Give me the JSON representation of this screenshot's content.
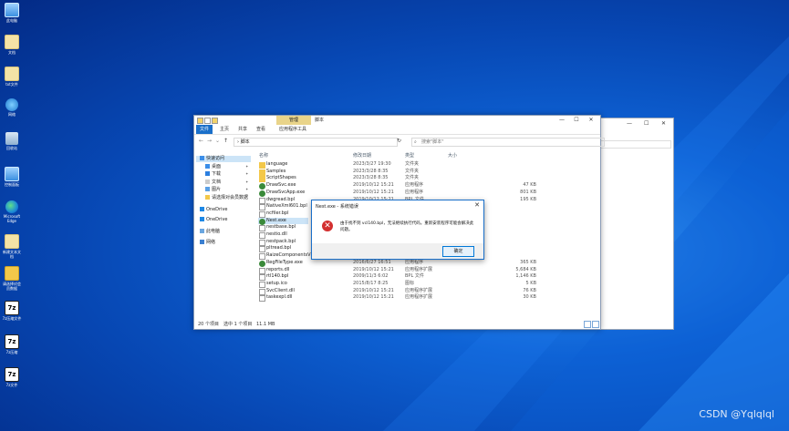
{
  "desktop": {
    "icons": [
      {
        "label": "此电脑",
        "icon": "computer-icon"
      },
      {
        "label": "文档",
        "icon": "document-icon"
      },
      {
        "label": "txt文件",
        "icon": "text-file-icon"
      },
      {
        "label": "网络",
        "icon": "network-icon"
      },
      {
        "label": "回收站",
        "icon": "recycle-bin-icon"
      },
      {
        "label": "控制面板",
        "icon": "control-panel-icon"
      },
      {
        "label": "Microsoft Edge",
        "icon": "edge-icon"
      },
      {
        "label": "新建文本文档",
        "icon": "text-file-icon"
      },
      {
        "label": "请选择对会员数据",
        "icon": "folder-icon"
      },
      {
        "label": "7z压缩文件",
        "icon": "7z-icon"
      },
      {
        "label": "7z压缩",
        "icon": "7z-icon"
      },
      {
        "label": "7z文件",
        "icon": "7z-icon"
      }
    ]
  },
  "window": {
    "context_tab": "管理",
    "title": "脚本",
    "minimize": "—",
    "maximize": "☐",
    "close": "✕",
    "ribbon_tabs": [
      "文件",
      "主页",
      "共享",
      "查看",
      "应用程序工具"
    ],
    "address": "脚本",
    "search_placeholder": "搜索\"脚本\"",
    "nav": [
      {
        "label": "快速访问",
        "pinned": false,
        "selected": true
      },
      {
        "label": "桌面",
        "pinned": true
      },
      {
        "label": "下载",
        "pinned": true
      },
      {
        "label": "文档",
        "pinned": true
      },
      {
        "label": "图片",
        "pinned": true
      },
      {
        "label": "请选择对会员数据",
        "pinned": false
      },
      {
        "label": "OneDrive",
        "pinned": false
      },
      {
        "label": "OneDrive",
        "pinned": false
      },
      {
        "label": "此电脑",
        "pinned": false
      },
      {
        "label": "网络",
        "pinned": false
      }
    ],
    "columns": {
      "name": "名称",
      "date": "修改日期",
      "type": "类型",
      "size": "大小"
    },
    "files": [
      {
        "name": "language",
        "date": "2023/3/27 19:30",
        "type": "文件夹",
        "size": "",
        "kind": "folder"
      },
      {
        "name": "Samples",
        "date": "2023/3/28 8:35",
        "type": "文件夹",
        "size": "",
        "kind": "folder"
      },
      {
        "name": "ScriptShapes",
        "date": "2023/3/28 8:35",
        "type": "文件夹",
        "size": "",
        "kind": "folder"
      },
      {
        "name": "DrawSvc.exe",
        "date": "2019/10/12 15:21",
        "type": "应用程序",
        "size": "47 KB",
        "kind": "exe"
      },
      {
        "name": "DrawSvcApp.exe",
        "date": "2019/10/12 15:21",
        "type": "应用程序",
        "size": "801 KB",
        "kind": "exe"
      },
      {
        "name": "dwgread.bpl",
        "date": "2019/10/12 15:21",
        "type": "BPL 文件",
        "size": "195 KB",
        "kind": "file"
      },
      {
        "name": "NativeXml601.bpl",
        "date": "",
        "type": "",
        "size": "",
        "kind": "file"
      },
      {
        "name": "ncfiler.bpl",
        "date": "",
        "type": "",
        "size": "",
        "kind": "file"
      },
      {
        "name": "Nest.exe",
        "date": "",
        "type": "",
        "size": "",
        "kind": "exe"
      },
      {
        "name": "nestbase.bpl",
        "date": "",
        "type": "",
        "size": "",
        "kind": "file"
      },
      {
        "name": "nestio.dll",
        "date": "",
        "type": "",
        "size": "",
        "kind": "file"
      },
      {
        "name": "nestpack.bpl",
        "date": "",
        "type": "",
        "size": "",
        "kind": "file"
      },
      {
        "name": "pltread.bpl",
        "date": "",
        "type": "",
        "size": "",
        "kind": "file"
      },
      {
        "name": "RaizeComponentsVcl",
        "date": "",
        "type": "",
        "size": "",
        "kind": "file"
      },
      {
        "name": "RegFileType.exe",
        "date": "2016/6/27 16:51",
        "type": "应用程序",
        "size": "365 KB",
        "kind": "exe"
      },
      {
        "name": "reports.dll",
        "date": "2019/10/12 15:21",
        "type": "应用程序扩展",
        "size": "5,684 KB",
        "kind": "file"
      },
      {
        "name": "rtl140.bpl",
        "date": "2009/11/3 6:02",
        "type": "BPL 文件",
        "size": "1,146 KB",
        "kind": "file"
      },
      {
        "name": "setup.ico",
        "date": "2015/8/17 8:25",
        "type": "图标",
        "size": "5 KB",
        "kind": "file"
      },
      {
        "name": "SvcClient.dll",
        "date": "2019/10/12 15:21",
        "type": "应用程序扩展",
        "size": "76 KB",
        "kind": "file"
      },
      {
        "name": "taskexpl.dll",
        "date": "2019/10/12 15:21",
        "type": "应用程序扩展",
        "size": "30 KB",
        "kind": "file"
      }
    ],
    "status": {
      "count": "20 个项目",
      "selected": "选中 1 个项目",
      "size": "11.1 MB"
    }
  },
  "dialog": {
    "title": "Nest.exe - 系统错误",
    "message": "由于找不到 vcl140.bpl，无法继续执行代码。重新安装程序可能会解决此问题。",
    "ok": "确定",
    "close": "✕"
  },
  "watermark": "CSDN @Yqlqlql",
  "colors": {
    "accent": "#1a6fc9",
    "selection": "#cce4f7",
    "error": "#d32f2f"
  }
}
